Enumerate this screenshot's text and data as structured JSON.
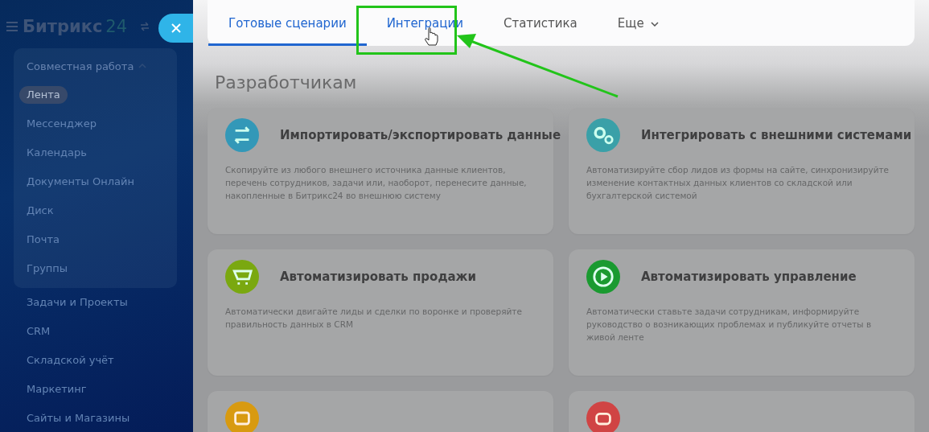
{
  "sidebar": {
    "logo_text": "Битрикс",
    "logo_number": "24",
    "sections": [
      {
        "label": "Совместная работа",
        "expanded": true,
        "children": [
          {
            "label": "Лента",
            "selected": true
          },
          {
            "label": "Мессенджер",
            "selected": false
          },
          {
            "label": "Календарь",
            "selected": false
          },
          {
            "label": "Документы Онлайн",
            "selected": false
          },
          {
            "label": "Диск",
            "selected": false
          },
          {
            "label": "Почта",
            "selected": false
          },
          {
            "label": "Группы",
            "selected": false
          }
        ]
      }
    ],
    "items": [
      {
        "label": "Задачи и Проекты",
        "selected": false
      },
      {
        "label": "CRM",
        "selected": false
      },
      {
        "label": "Складской учёт",
        "selected": false
      },
      {
        "label": "Маркетинг",
        "selected": false
      },
      {
        "label": "Сайты и Магазины",
        "selected": false
      }
    ]
  },
  "tabs": [
    {
      "label": "Готовые сценарии",
      "selected": true
    },
    {
      "label": "Интеграции",
      "selected": false
    },
    {
      "label": "Статистика",
      "selected": false
    },
    {
      "label": "Еще",
      "selected": false,
      "dropdown": true
    }
  ],
  "heading": "Разработчикам",
  "cards": [
    {
      "title": "Импортировать/экспортировать данные",
      "description": "Скопируйте из любого внешнего источника данные клиентов, перечень сотрудников, задачи или, наоборот, перенесите данные, накопленные в Битрикс24 во внешнюю систему",
      "color": "#3398b8"
    },
    {
      "title": "Интегрировать с внешними системами",
      "description": "Автоматизируйте сбор лидов из формы на сайте, синхронизируйте изменение контактных данных клиентов со складской или бухгалтерской системой",
      "color": "#3aa0a8"
    },
    {
      "title": "Автоматизировать продажи",
      "description": "Автоматически двигайте лиды и сделки по воронке и проверяйте правильность данных в CRM",
      "color": "#7aa810"
    },
    {
      "title": "Автоматизировать управление",
      "description": "Автоматически ставьте задачи сотрудникам, информируйте руководство о возникающих проблемах и публикуйте отчеты в живой ленте",
      "color": "#1a9a30"
    },
    {
      "color": "#d89a10"
    },
    {
      "color": "#d04444"
    }
  ]
}
